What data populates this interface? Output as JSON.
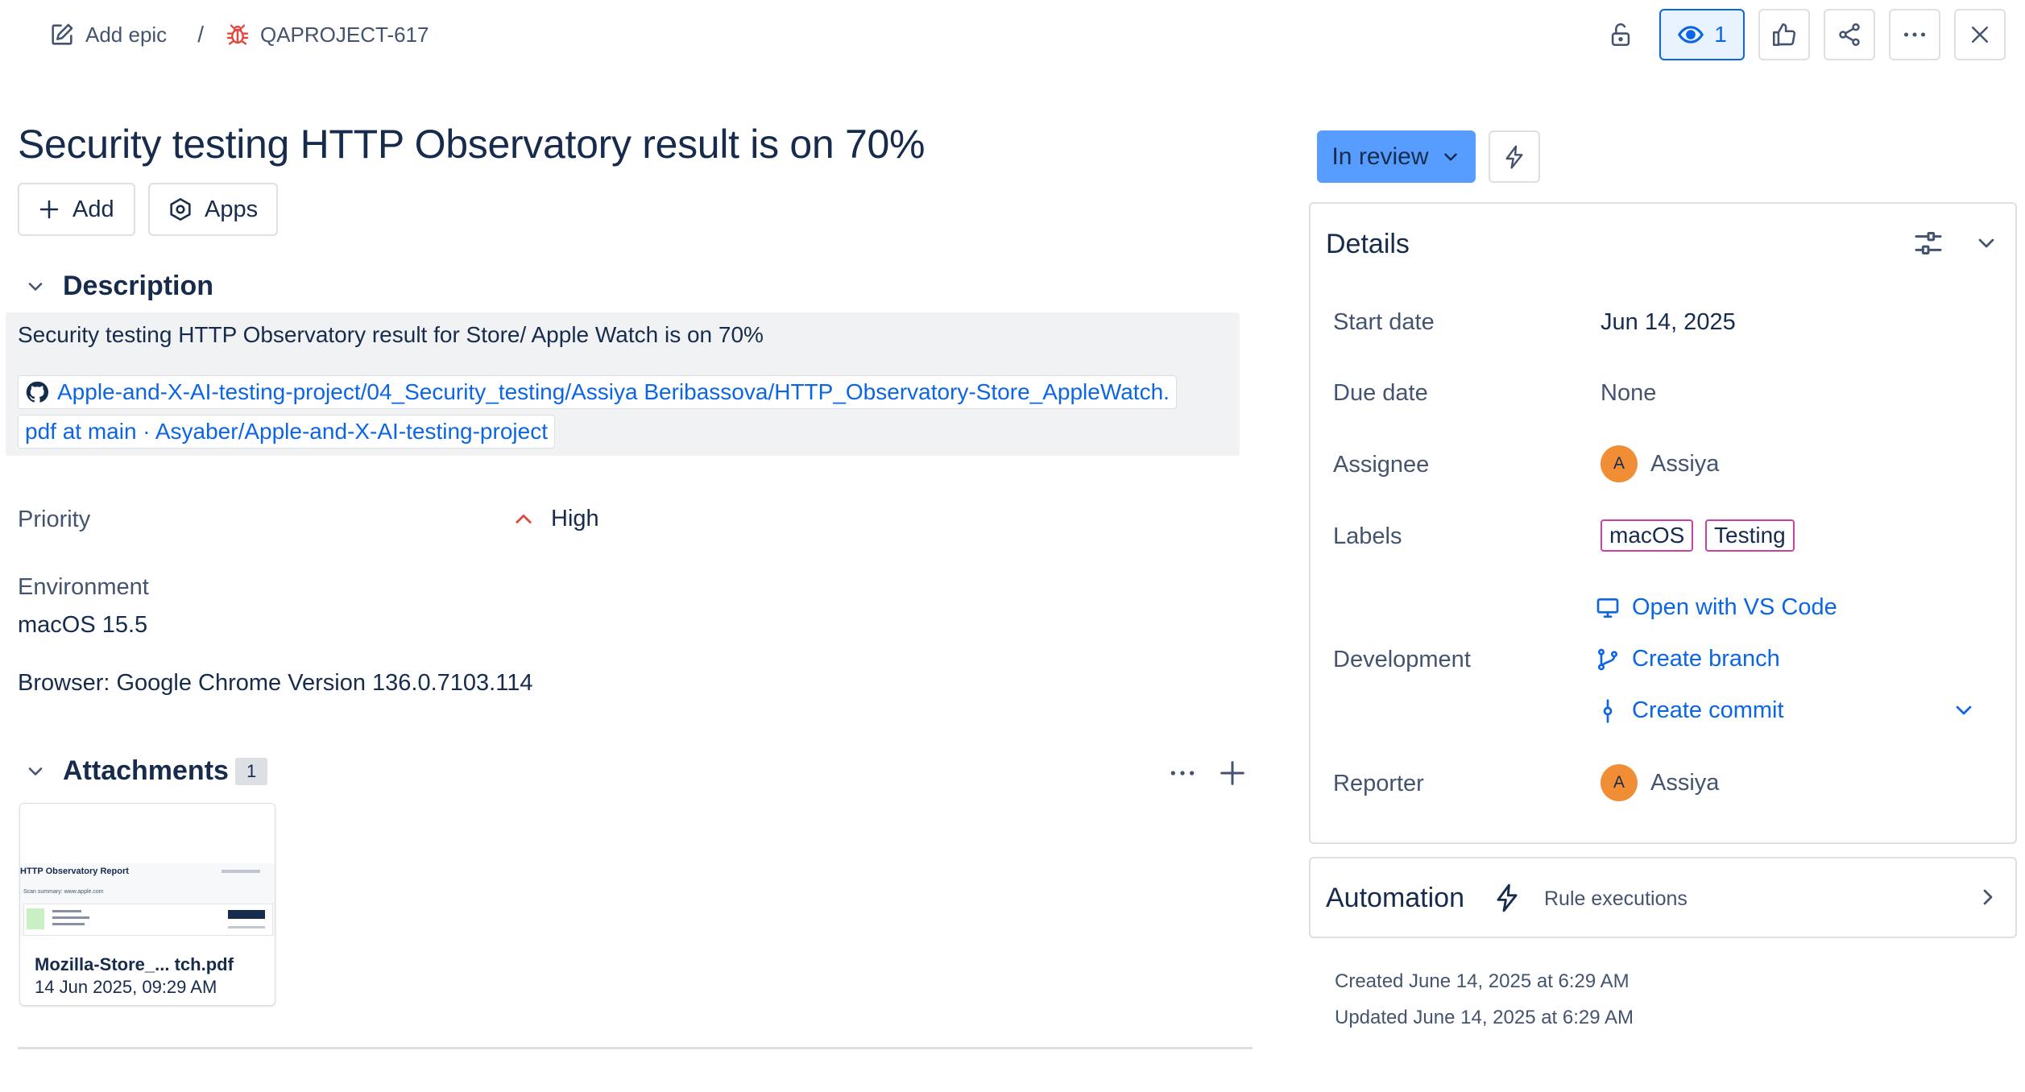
{
  "breadcrumb": {
    "add_epic": "Add epic",
    "separator": "/",
    "issue_key": "QAPROJECT-617"
  },
  "toolbar": {
    "watch_count": "1",
    "icons": [
      "unlock-icon",
      "eye-icon",
      "thumbs-up-icon",
      "share-icon",
      "more-icon",
      "close-icon"
    ]
  },
  "issue": {
    "title": "Security testing HTTP Observatory result is on 70%",
    "add_label": "Add",
    "apps_label": "Apps"
  },
  "description": {
    "heading": "Description",
    "text": "Security testing HTTP Observatory result for Store/ Apple Watch is on 70%",
    "link_line1": "Apple-and-X-AI-testing-project/04_Security_testing/Assiya Beribassova/HTTP_Observatory-Store_AppleWatch.",
    "link_line2": "pdf at main · Asyaber/Apple-and-X-AI-testing-project"
  },
  "fields": {
    "priority_label": "Priority",
    "priority_value": "High",
    "environment_label": "Environment",
    "environment_value": "macOS 15.5",
    "browser_text": "Browser: Google Chrome Version 136.0.7103.114"
  },
  "attachments": {
    "heading": "Attachments",
    "count": "1",
    "items": [
      {
        "name": "Mozilla-Store_... tch.pdf",
        "date": "14 Jun 2025, 09:29 AM",
        "thumb_title": "HTTP Observatory Report",
        "thumb_summary": "Scan summary: www.apple.com"
      }
    ]
  },
  "status": {
    "label": "In review"
  },
  "details": {
    "heading": "Details",
    "start_date_label": "Start date",
    "start_date_value": "Jun 14, 2025",
    "due_date_label": "Due date",
    "due_date_value": "None",
    "assignee_label": "Assignee",
    "assignee_name": "Assiya",
    "assignee_initial": "A",
    "labels_label": "Labels",
    "labels": [
      "macOS",
      "Testing"
    ],
    "development_label": "Development",
    "dev_open_vscode": "Open with VS Code",
    "dev_create_branch": "Create branch",
    "dev_create_commit": "Create commit",
    "reporter_label": "Reporter",
    "reporter_name": "Assiya",
    "reporter_initial": "A"
  },
  "automation": {
    "heading": "Automation",
    "rule_executions": "Rule executions"
  },
  "meta": {
    "created": "Created June 14, 2025 at 6:29 AM",
    "updated": "Updated June 14, 2025 at 6:29 AM"
  },
  "colors": {
    "link": "#0c66e4",
    "status_bg": "#579dff",
    "priority_high": "#e2483d",
    "label_border": "#ca3fa8",
    "avatar_bg": "#f18d35",
    "bug_icon": "#e2483d"
  }
}
